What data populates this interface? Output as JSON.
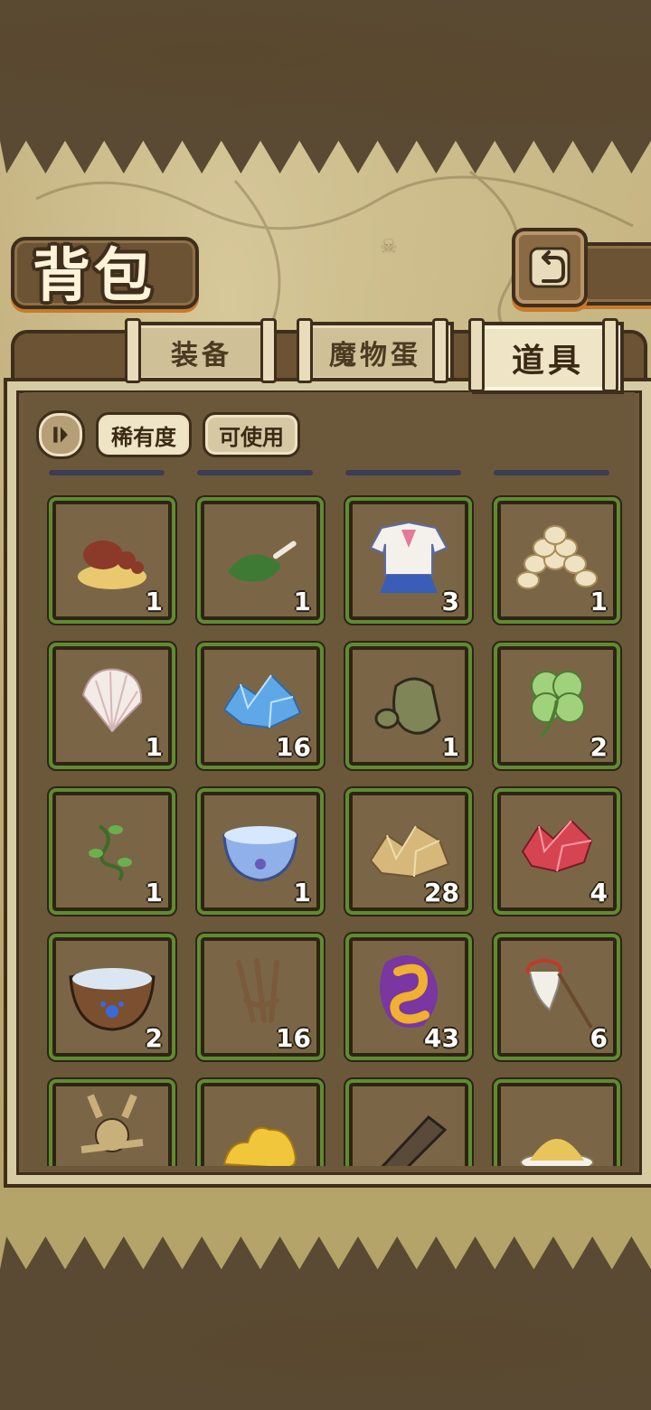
{
  "header": {
    "title": "背包",
    "back_icon": "return-arrow-icon"
  },
  "tabs": [
    {
      "label": "装备",
      "active": false
    },
    {
      "label": "魔物蛋",
      "active": false
    },
    {
      "label": "道具",
      "active": true
    }
  ],
  "filters": {
    "sort_icon": "sort-toggle-icon",
    "rarity": "稀有度",
    "usable": "可使用"
  },
  "items": [
    {
      "name": "mushroom-icon",
      "count": "1"
    },
    {
      "name": "herb-bone-icon",
      "count": "1"
    },
    {
      "name": "sailor-uniform-icon",
      "count": "3"
    },
    {
      "name": "eggs-pile-icon",
      "count": "1"
    },
    {
      "name": "seashell-icon",
      "count": "1"
    },
    {
      "name": "blue-crystal-icon",
      "count": "16"
    },
    {
      "name": "stone-icon",
      "count": "1"
    },
    {
      "name": "four-leaf-clover-icon",
      "count": "2"
    },
    {
      "name": "vine-sprout-icon",
      "count": "1"
    },
    {
      "name": "water-bowl-icon",
      "count": "1"
    },
    {
      "name": "gold-ore-icon",
      "count": "28"
    },
    {
      "name": "red-crystal-icon",
      "count": "4"
    },
    {
      "name": "paw-bowl-icon",
      "count": "2"
    },
    {
      "name": "wooden-fork-icon",
      "count": "16"
    },
    {
      "name": "purple-flame-rune-icon",
      "count": "43"
    },
    {
      "name": "bug-net-icon",
      "count": "6"
    },
    {
      "name": "voodoo-doll-icon",
      "count": ""
    },
    {
      "name": "yellow-slime-icon",
      "count": ""
    },
    {
      "name": "wood-plank-icon",
      "count": ""
    },
    {
      "name": "sand-dish-icon",
      "count": ""
    }
  ]
}
